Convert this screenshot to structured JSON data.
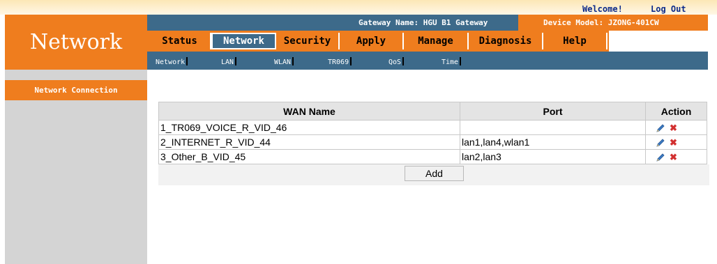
{
  "header": {
    "welcome": "Welcome!",
    "logout": "Log Out",
    "gateway_name": "Gateway Name: HGU B1 Gateway",
    "device_model": "Device Model: JZONG-401CW"
  },
  "logo_title": "Network",
  "tabs": [
    {
      "label": "Status"
    },
    {
      "label": "Network"
    },
    {
      "label": "Security"
    },
    {
      "label": "Apply"
    },
    {
      "label": "Manage"
    },
    {
      "label": "Diagnosis"
    },
    {
      "label": "Help"
    }
  ],
  "subtabs": [
    "Network",
    "LAN",
    "WLAN",
    "TR069",
    "QoS",
    "Time"
  ],
  "sidebar": {
    "active_item": "Network Connection"
  },
  "table": {
    "headers": [
      "WAN Name",
      "Port",
      "Action"
    ],
    "rows": [
      {
        "name": "1_TR069_VOICE_R_VID_46",
        "port": ""
      },
      {
        "name": "2_INTERNET_R_VID_44",
        "port": "lan1,lan4,wlan1"
      },
      {
        "name": "3_Other_B_VID_45",
        "port": "lan2,lan3"
      }
    ]
  },
  "add_label": "Add",
  "colors": {
    "accent": "#ef7d1e",
    "nav_blue": "#3d6a8a",
    "sidebar_gray": "#d4d4d4"
  },
  "icons": {
    "edit": "pencil-icon",
    "delete": "x-icon"
  }
}
